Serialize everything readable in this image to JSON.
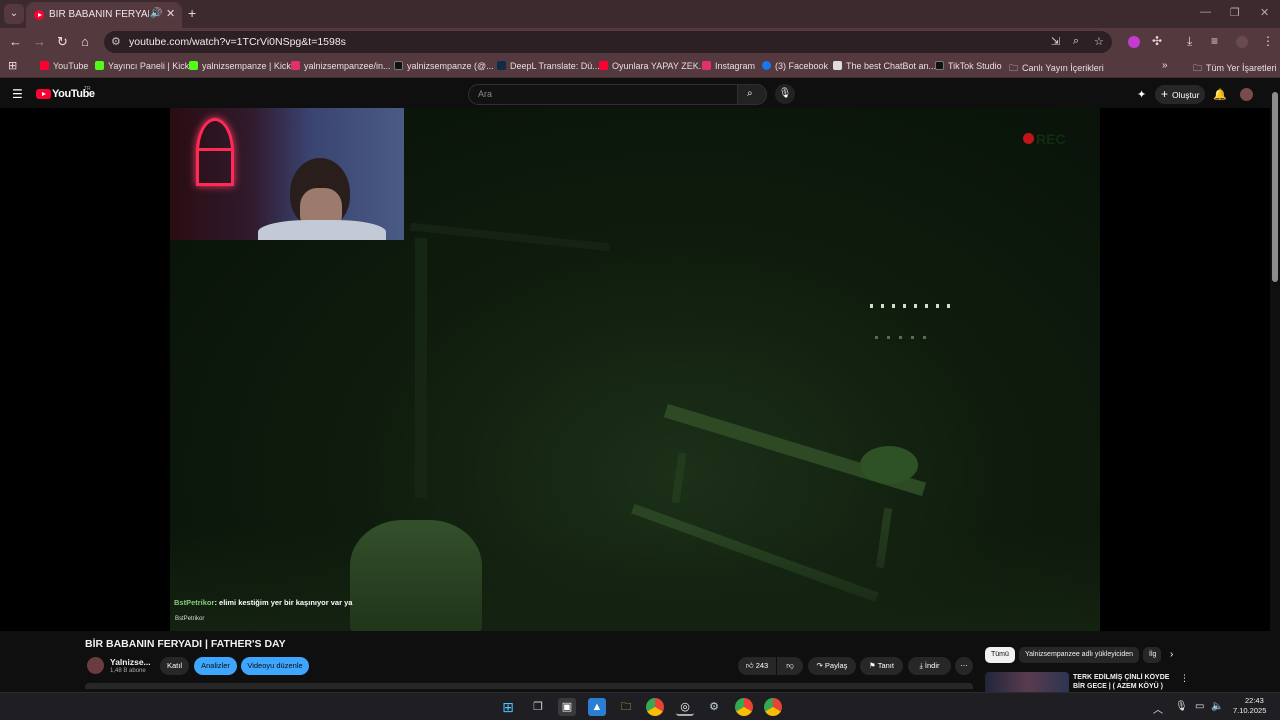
{
  "browser": {
    "tab_title": "BİR BABANIN FERYADI | FATHER'S DAY",
    "url": "youtube.com/watch?v=1TCrVi0NSpg&t=1598s",
    "bookmarks": [
      {
        "label": "YouTube",
        "color": "#ff0033"
      },
      {
        "label": "Yayıncı Paneli | Kick",
        "color": "#53fc18"
      },
      {
        "label": "yalnizsempanze | Kick",
        "color": "#53fc18"
      },
      {
        "label": "yalnizsempanzee/in...",
        "color": "#e1306c"
      },
      {
        "label": "yalnizsempanze (@...",
        "color": "#111111"
      },
      {
        "label": "DeepL Translate: Dü...",
        "color": "#0f2b46"
      },
      {
        "label": "Oyunlara YAPAY ZEK...",
        "color": "#ff0033"
      },
      {
        "label": "Instagram",
        "color": "#e1306c"
      },
      {
        "label": "(3) Facebook",
        "color": "#1877f2"
      },
      {
        "label": "The best ChatBot an...",
        "color": "#dddddd"
      },
      {
        "label": "TikTok Studio",
        "color": "#111111"
      },
      {
        "label": "Canlı Yayın İçerikleri",
        "color": "#54393f"
      }
    ],
    "all_bookmarks_label": "Tüm Yer İşaretleri"
  },
  "youtube": {
    "logo_text": "YouTube",
    "country_code": "TR",
    "search_placeholder": "Ara",
    "create_label": "Oluştur"
  },
  "video": {
    "rec_label": "REC",
    "chat_user": "BstPetrikor",
    "chat_message": ": elimi kestiğim yer bir kaşınıyor var ya",
    "chat_footer": "BstPetrikor"
  },
  "details": {
    "title": "BİR BABANIN FERYADI | FATHER'S DAY",
    "channel_name": "Yalnizse...",
    "subscribers": "1,48 B abone",
    "join_label": "Katıl",
    "analytics_label": "Analizler",
    "edit_label": "Videoyu düzenle",
    "likes": "243",
    "share_label": "Paylaş",
    "promote_label": "Tanıt",
    "download_label": "İndir"
  },
  "sidebar": {
    "chips": [
      "Tümü",
      "Yalnizsempanzee adlı yükleyiciden",
      "İlg"
    ],
    "rec_title": "TERK EDİLMİŞ ÇİNLİ KÖYDE BİR GECE | ( AZEM KÖYÜ )"
  },
  "taskbar": {
    "time": "22:43",
    "date": "7.10.2025"
  }
}
